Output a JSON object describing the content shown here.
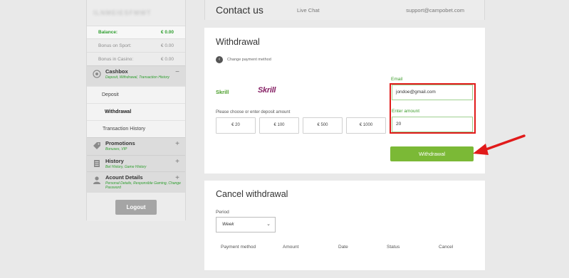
{
  "sidebar": {
    "username": "ILNMEIESFMWT",
    "balances": [
      {
        "label": "Balance:",
        "value": "€ 0.00"
      },
      {
        "label": "Bonus on Sport:",
        "value": "€ 0.00"
      },
      {
        "label": "Bonus in Casino:",
        "value": "€ 0.00"
      }
    ],
    "cashbox": {
      "title": "Cashbox",
      "subtitle": "Deposit, Withdrawal, Transaction History",
      "toggle": "−"
    },
    "cashbox_items": [
      "Deposit",
      "Withdrawal",
      "Transaction History"
    ],
    "promotions": {
      "title": "Promotions",
      "subtitle": "Bonuses, VIP",
      "toggle": "+"
    },
    "history": {
      "title": "History",
      "subtitle": "Bet History, Game History",
      "toggle": "+"
    },
    "account": {
      "title": "Acount Details",
      "subtitle": "Personal Details, Responsible Gaming, Change Password",
      "toggle": "+"
    },
    "logout_label": "Logout"
  },
  "header": {
    "title": "Contact us",
    "live_chat": "Live Chat",
    "email": "support@campobet.com"
  },
  "withdrawal": {
    "title": "Withdrawal",
    "change_method": "Change payment method",
    "method_name": "Skrill",
    "method_logo": "Skrill",
    "choose_label": "Please choose or enter deposit amount",
    "amounts": [
      "€ 20",
      "€ 100",
      "€ 500",
      "€ 1000"
    ],
    "email_label": "Email",
    "email_value": "jondoe@gmail.com",
    "amount_label": "Enter amount",
    "amount_value": "20",
    "submit_label": "Withdrawal"
  },
  "cancel": {
    "title": "Cancel withdrawal",
    "period_label": "Period",
    "period_value": "Week",
    "columns": [
      "Payment method",
      "Amount",
      "Date",
      "Status",
      "Cancel"
    ]
  },
  "colors": {
    "accent_green": "#7bb936",
    "highlight_red": "#e11a1a",
    "skrill_purple": "#862165"
  }
}
